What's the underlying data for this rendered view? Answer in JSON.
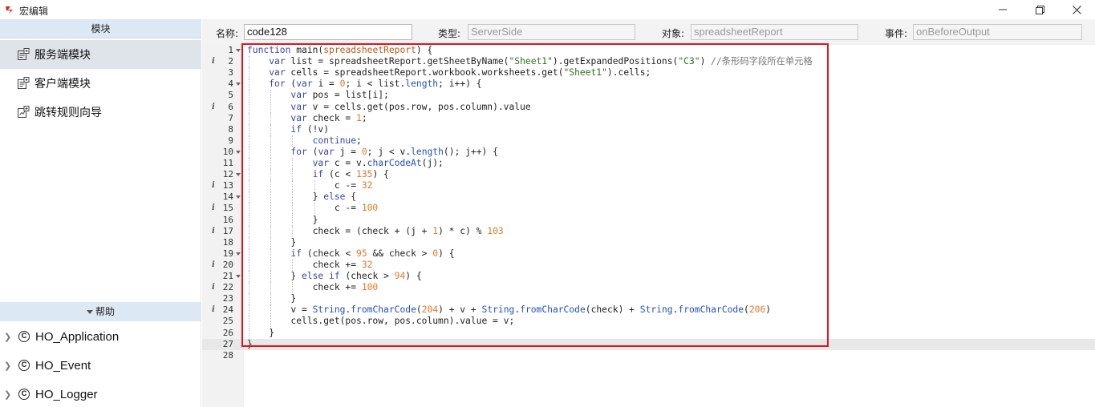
{
  "window": {
    "title": "宏编辑",
    "controls": {
      "minimize": "minimize-icon",
      "maximize": "restore-icon",
      "close": "close-icon"
    }
  },
  "sidebar": {
    "modules_header": "模块",
    "items": [
      {
        "label": "服务端模块",
        "icon": "server-module-icon",
        "active": true
      },
      {
        "label": "客户端模块",
        "icon": "client-module-icon",
        "active": false
      },
      {
        "label": "跳转规则向导",
        "icon": "jump-rule-wizard-icon",
        "active": false
      }
    ],
    "help_header": "帮助",
    "help_items": [
      {
        "label": "HO_Application"
      },
      {
        "label": "HO_Event"
      },
      {
        "label": "HO_Logger"
      }
    ]
  },
  "properties": {
    "name_label": "名称:",
    "name_value": "code128",
    "type_label": "类型:",
    "type_value": "ServerSide",
    "object_label": "对象:",
    "object_value": "spreadsheetReport",
    "event_label": "事件:",
    "event_value": "onBeforeOutput"
  },
  "editor": {
    "lines": [
      "function main(spreadsheetReport) {",
      "    var list = spreadsheetReport.getSheetByName(\"Sheet1\").getExpandedPositions(\"C3\") //条形码字段所在单元格",
      "    var cells = spreadsheetReport.workbook.worksheets.get(\"Sheet1\").cells;",
      "    for (var i = 0; i < list.length; i++) {",
      "        var pos = list[i];",
      "        var v = cells.get(pos.row, pos.column).value",
      "        var check = 1;",
      "        if (!v)",
      "            continue;",
      "        for (var j = 0; j < v.length(); j++) {",
      "            var c = v.charCodeAt(j);",
      "            if (c < 135) {",
      "                c -= 32",
      "            } else {",
      "                c -= 100",
      "            }",
      "            check = (check + (j + 1) * c) % 103",
      "        }",
      "        if (check < 95 && check > 0) {",
      "            check += 32",
      "        } else if (check > 94) {",
      "            check += 100",
      "        }",
      "        v = String.fromCharCode(204) + v + String.fromCharCode(check) + String.fromCharCode(206)",
      "        cells.get(pos.row, pos.column).value = v;",
      "    }",
      "}"
    ],
    "info_lines": [
      2,
      6,
      13,
      15,
      17,
      20,
      22,
      24
    ],
    "fold_lines": [
      1,
      4,
      10,
      12,
      14,
      19,
      21
    ],
    "current_line": 27
  },
  "colors": {
    "highlight_border": "#e0141d",
    "keyword": "#3a45a8",
    "string": "#2f6f1f",
    "number": "#e0792a"
  }
}
